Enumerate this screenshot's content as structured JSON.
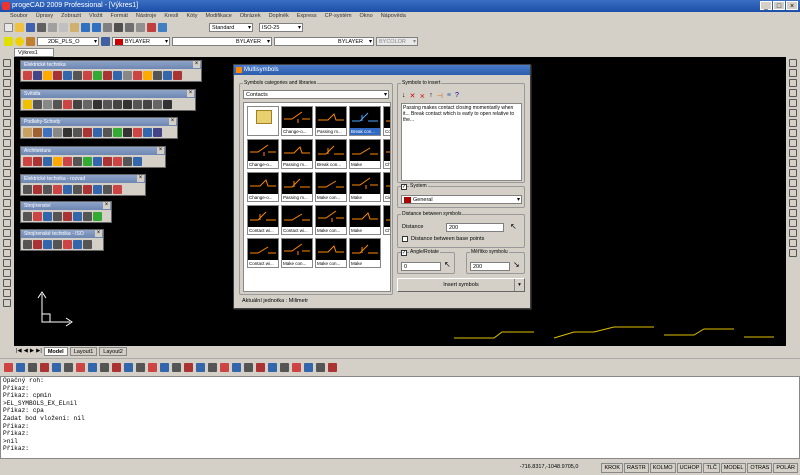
{
  "window": {
    "title": "progeCAD 2009 Professional - [Výkres1]"
  },
  "menu": [
    "Soubor",
    "Úpravy",
    "Zobrazit",
    "Vložit",
    "Formát",
    "Nástroje",
    "Kreslí",
    "Kóty",
    "Modifikace",
    "Obrázek",
    "Doplněk",
    "Express",
    "CP-systém",
    "Okno",
    "Nápověda"
  ],
  "toolbar": {
    "textstyle": "Standard",
    "dimstyle": "ISO-25",
    "layer": "2DE_PLS_O",
    "color": "BYLAYER",
    "linetype": "BYLAYER",
    "lineweight": "BYLAYER",
    "plotstyle": "BYCOLOR"
  },
  "doc_tab": "Výkres1",
  "panels": [
    {
      "title": "Elektrické technika"
    },
    {
      "title": "Svítidla"
    },
    {
      "title": "Podlahy-Schody"
    },
    {
      "title": "Architektura"
    },
    {
      "title": "Elektrické technika - rozvad"
    },
    {
      "title": "Strojírenství"
    },
    {
      "title": "Strojírenské technika - ISO"
    }
  ],
  "dialog": {
    "title": "Multisymbols",
    "categories_label": "Symbols categories and libraries",
    "category_value": "Contacts",
    "insert_label": "Symbols to insert",
    "description": "Passing makes contact closing momentarily when it... Break contact which is early to open relative to the...",
    "symbols": [
      {
        "label": ""
      },
      {
        "label": "Change-o..."
      },
      {
        "label": "Passing m..."
      },
      {
        "label": "Break con..."
      },
      {
        "label": "Contactor"
      },
      {
        "label": "Change-o..."
      },
      {
        "label": "Passing m..."
      },
      {
        "label": "Break con..."
      },
      {
        "label": "Make"
      },
      {
        "label": "Change-o..."
      },
      {
        "label": "Change-o..."
      },
      {
        "label": "Passing m..."
      },
      {
        "label": "Make con..."
      },
      {
        "label": "Make"
      },
      {
        "label": "Circuit Bre..."
      },
      {
        "label": "Contact wi..."
      },
      {
        "label": "Contact wi..."
      },
      {
        "label": "Make con..."
      },
      {
        "label": "Make"
      },
      {
        "label": "Change-o..."
      },
      {
        "label": "Contact wi..."
      },
      {
        "label": "Make con..."
      },
      {
        "label": "Make con..."
      },
      {
        "label": "Make"
      }
    ],
    "system_label": "System",
    "system_value": "General",
    "distance_group": "Distance between symbols",
    "distance_label": "Distance",
    "distance_value": "200",
    "base_points_label": "Distance between base points",
    "angle_label": "Angle/Rotate",
    "angle_value": "0",
    "scale_label": "Měřítko symbolu",
    "scale_value": "200",
    "insert_button": "Insert symbols",
    "units_text": "Aktuální jednotka : Milimetr"
  },
  "layout_tabs": [
    "Model",
    "Layout1",
    "Layout2"
  ],
  "command_history": [
    "Opačný roh:",
    "Příkaz:",
    "Příkaz: cpmin",
    " >EL_SYMBOLS_EX_ELnil",
    "Příkaz: cpa",
    "Zadat bod vložení: nil",
    "Příkaz:",
    "Příkaz:",
    " >nil",
    "Příkaz:"
  ],
  "status": {
    "coords": "-716.8317,-1048.9705,0",
    "items": [
      "KROK",
      "RASTR",
      "KOLMO",
      "UCHOP",
      "TLČ",
      "MODEL",
      "OTRAS",
      "POLÁR"
    ]
  },
  "colors": {
    "accent": "#316ac5",
    "drawing_bg": "#000000",
    "symbol_line": "#ff8800",
    "symbol_blue": "#4da6ff"
  }
}
